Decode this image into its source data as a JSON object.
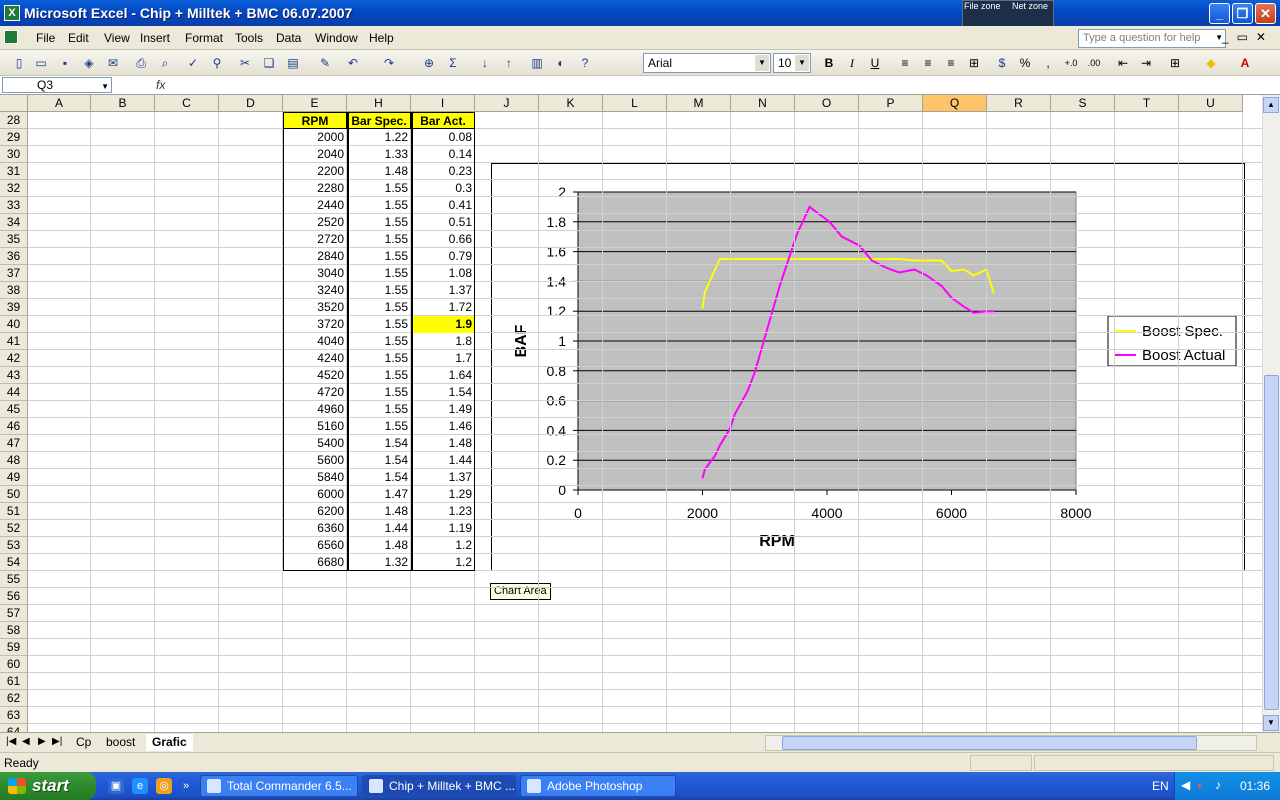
{
  "window": {
    "title": "Microsoft Excel - Chip + Milltek + BMC 06.07.2007",
    "zone1": "File zone",
    "zone2": "Net zone"
  },
  "menu": [
    "File",
    "Edit",
    "View",
    "Insert",
    "Format",
    "Tools",
    "Data",
    "Window",
    "Help"
  ],
  "help_placeholder": "Type a question for help",
  "toolbar": {
    "font": "Arial",
    "size": "10"
  },
  "namebox": "Q3",
  "fx": "fx",
  "columns": [
    {
      "l": "A",
      "w": 64
    },
    {
      "l": "B",
      "w": 64
    },
    {
      "l": "C",
      "w": 64
    },
    {
      "l": "D",
      "w": 64
    },
    {
      "l": "E",
      "w": 64
    },
    {
      "l": "H",
      "w": 64
    },
    {
      "l": "I",
      "w": 64
    },
    {
      "l": "J",
      "w": 64
    },
    {
      "l": "K",
      "w": 64
    },
    {
      "l": "L",
      "w": 64
    },
    {
      "l": "M",
      "w": 64
    },
    {
      "l": "N",
      "w": 64
    },
    {
      "l": "O",
      "w": 64
    },
    {
      "l": "P",
      "w": 64
    },
    {
      "l": "Q",
      "w": 64
    },
    {
      "l": "R",
      "w": 64
    },
    {
      "l": "S",
      "w": 64
    },
    {
      "l": "T",
      "w": 64
    },
    {
      "l": "U",
      "w": 64
    }
  ],
  "selected_column": "Q",
  "row_start": 28,
  "row_end": 64,
  "table": {
    "headers": [
      "RPM",
      "Bar Spec.",
      "Bar Act."
    ],
    "rows": [
      [
        "2000",
        "1.22",
        "0.08"
      ],
      [
        "2040",
        "1.33",
        "0.14"
      ],
      [
        "2200",
        "1.48",
        "0.23"
      ],
      [
        "2280",
        "1.55",
        "0.3"
      ],
      [
        "2440",
        "1.55",
        "0.41"
      ],
      [
        "2520",
        "1.55",
        "0.51"
      ],
      [
        "2720",
        "1.55",
        "0.66"
      ],
      [
        "2840",
        "1.55",
        "0.79"
      ],
      [
        "3040",
        "1.55",
        "1.08"
      ],
      [
        "3240",
        "1.55",
        "1.37"
      ],
      [
        "3520",
        "1.55",
        "1.72"
      ],
      [
        "3720",
        "1.55",
        "1.9"
      ],
      [
        "4040",
        "1.55",
        "1.8"
      ],
      [
        "4240",
        "1.55",
        "1.7"
      ],
      [
        "4520",
        "1.55",
        "1.64"
      ],
      [
        "4720",
        "1.55",
        "1.54"
      ],
      [
        "4960",
        "1.55",
        "1.49"
      ],
      [
        "5160",
        "1.55",
        "1.46"
      ],
      [
        "5400",
        "1.54",
        "1.48"
      ],
      [
        "5600",
        "1.54",
        "1.44"
      ],
      [
        "5840",
        "1.54",
        "1.37"
      ],
      [
        "6000",
        "1.47",
        "1.29"
      ],
      [
        "6200",
        "1.48",
        "1.23"
      ],
      [
        "6360",
        "1.44",
        "1.19"
      ],
      [
        "6560",
        "1.48",
        "1.2"
      ],
      [
        "6680",
        "1.32",
        "1.2"
      ]
    ],
    "highlight_row": 11
  },
  "chart_data": {
    "type": "line",
    "xlabel": "RPM",
    "ylabel": "BAF",
    "xlim": [
      0,
      8000
    ],
    "ylim": [
      0,
      2
    ],
    "xticks": [
      "0",
      "2000",
      "4000",
      "6000",
      "8000"
    ],
    "yticks": [
      "0",
      "0.2",
      "0.4",
      "0.6",
      "0.8",
      "1",
      "1.2",
      "1.4",
      "1.6",
      "1.8",
      "2"
    ],
    "x": [
      2000,
      2040,
      2200,
      2280,
      2440,
      2520,
      2720,
      2840,
      3040,
      3240,
      3520,
      3720,
      4040,
      4240,
      4520,
      4720,
      4960,
      5160,
      5400,
      5600,
      5840,
      6000,
      6200,
      6360,
      6560,
      6680
    ],
    "series": [
      {
        "name": "Boost Spec.",
        "color": "#ffff00",
        "values": [
          1.22,
          1.33,
          1.48,
          1.55,
          1.55,
          1.55,
          1.55,
          1.55,
          1.55,
          1.55,
          1.55,
          1.55,
          1.55,
          1.55,
          1.55,
          1.55,
          1.55,
          1.55,
          1.54,
          1.54,
          1.54,
          1.47,
          1.48,
          1.44,
          1.48,
          1.32
        ]
      },
      {
        "name": "Boost Actual",
        "color": "#ff00ff",
        "values": [
          0.08,
          0.14,
          0.23,
          0.3,
          0.41,
          0.51,
          0.66,
          0.79,
          1.08,
          1.37,
          1.72,
          1.9,
          1.8,
          1.7,
          1.64,
          1.54,
          1.49,
          1.46,
          1.48,
          1.44,
          1.37,
          1.29,
          1.23,
          1.19,
          1.2,
          1.2
        ]
      }
    ],
    "plot_bg": "#c0c0c0",
    "grid": true,
    "legend": "right"
  },
  "tooltip": "Chart Area",
  "sheets": [
    "Cp",
    "boost",
    "Grafic"
  ],
  "active_sheet": "Grafic",
  "status": "Ready",
  "taskbar": {
    "start": "start",
    "tasks": [
      "Total Commander 6.5...",
      "Chip + Milltek + BMC ...",
      "Adobe Photoshop"
    ],
    "active_task": 1,
    "lang": "EN",
    "clock": "01:36"
  }
}
